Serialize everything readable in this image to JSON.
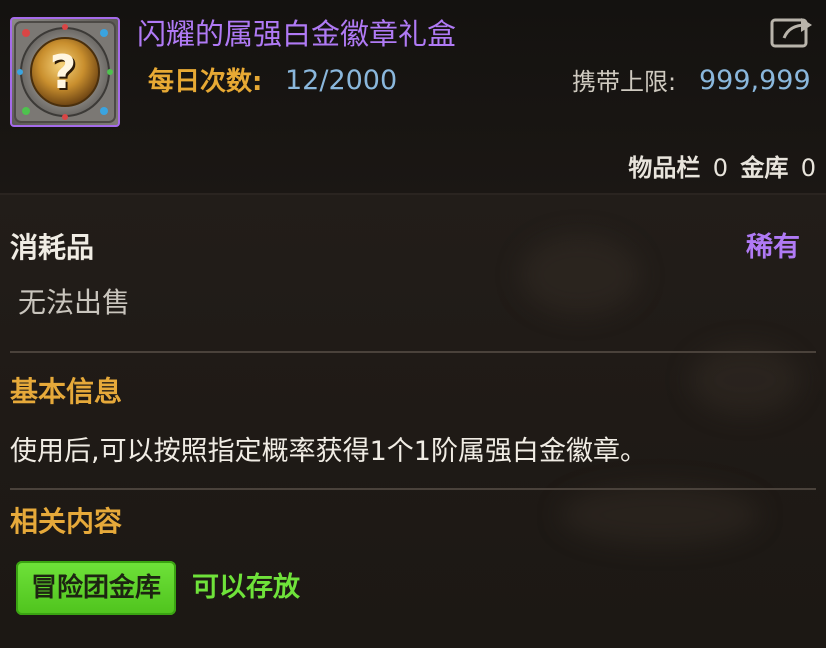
{
  "item": {
    "name": "闪耀的属强白金徽章礼盒",
    "icon": "question-mark-icon",
    "name_color": "#b07af5"
  },
  "header": {
    "daily_label": "每日次数:",
    "daily_value": "12/2000",
    "carry_label": "携带上限:",
    "carry_value": "999,999",
    "share_icon": "share-export-icon"
  },
  "storage": {
    "inventory_label": "物品栏",
    "inventory_count": "0",
    "vault_label": "金库",
    "vault_count": "0"
  },
  "details": {
    "category": "消耗品",
    "rarity": "稀有",
    "sale_status": "无法出售"
  },
  "basic_info": {
    "title": "基本信息",
    "description": "使用后,可以按照指定概率获得1个1阶属强白金徽章。"
  },
  "related": {
    "title": "相关内容",
    "guild_vault_tag": "冒险团金库",
    "storable_text": "可以存放"
  },
  "colors": {
    "accent_purple": "#b07af5",
    "label_gold": "#e6a93a",
    "value_blue": "#8ab7dc",
    "green": "#6fe23a"
  }
}
